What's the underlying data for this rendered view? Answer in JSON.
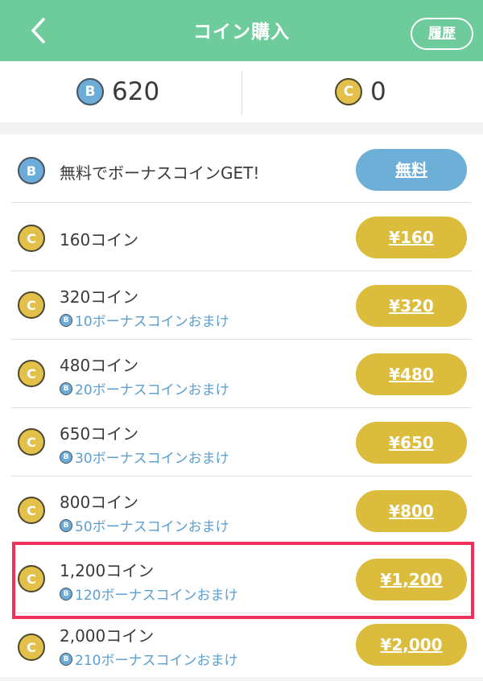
{
  "header": {
    "title": "コイン購入",
    "history_label": "履歴"
  },
  "balance": {
    "bonus": {
      "icon_letter": "B",
      "value": "620"
    },
    "coin": {
      "icon_letter": "C",
      "value": "0"
    }
  },
  "colors": {
    "accent": "#6dcb9c",
    "gold": "#dbbc3c",
    "blue": "#6eafd8",
    "highlight": "#f0325a"
  },
  "items": [
    {
      "icon": "B",
      "name": "無料でボーナスコインGET!",
      "bonus": "",
      "price": "無料"
    },
    {
      "icon": "C",
      "name": "160コイン",
      "bonus": "",
      "price": "¥160"
    },
    {
      "icon": "C",
      "name": "320コイン",
      "bonus": "10ボーナスコインおまけ",
      "price": "¥320"
    },
    {
      "icon": "C",
      "name": "480コイン",
      "bonus": "20ボーナスコインおまけ",
      "price": "¥480"
    },
    {
      "icon": "C",
      "name": "650コイン",
      "bonus": "30ボーナスコインおまけ",
      "price": "¥650"
    },
    {
      "icon": "C",
      "name": "800コイン",
      "bonus": "50ボーナスコインおまけ",
      "price": "¥800"
    },
    {
      "icon": "C",
      "name": "1,200コイン",
      "bonus": "120ボーナスコインおまけ",
      "price": "¥1,200"
    },
    {
      "icon": "C",
      "name": "2,000コイン",
      "bonus": "210ボーナスコインおまけ",
      "price": "¥2,000"
    }
  ],
  "mini_icon_letter": "B"
}
